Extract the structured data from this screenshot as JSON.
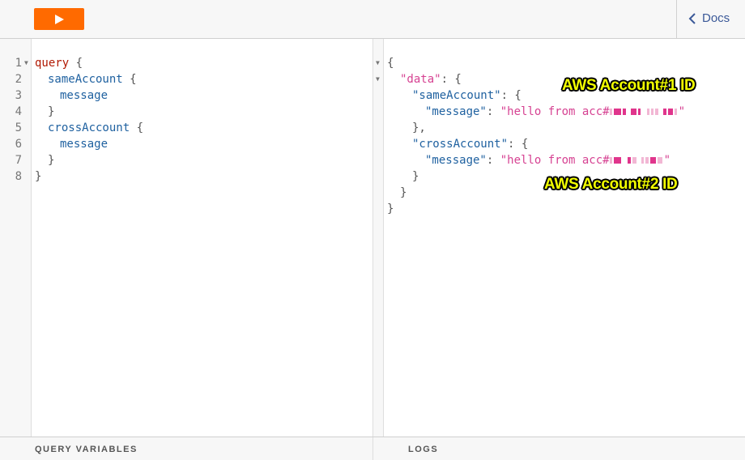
{
  "toolbar": {
    "run_icon": "play-icon",
    "docs_label": "Docs",
    "docs_icon": "chevron-left-icon",
    "accent_color": "#ff6a00"
  },
  "query_editor": {
    "line_numbers": [
      "1",
      "2",
      "3",
      "4",
      "5",
      "6",
      "7",
      "8"
    ],
    "tokens": {
      "l1_kw": "query",
      "l1_brace": " {",
      "l2_field": "sameAccount",
      "l2_brace": " {",
      "l3_field": "message",
      "l4_brace": "}",
      "l5_field": "crossAccount",
      "l5_brace": " {",
      "l6_field": "message",
      "l7_brace": "}",
      "l8_brace": "}"
    }
  },
  "result_viewer": {
    "tokens": {
      "open": "{",
      "data_key": "\"data\"",
      "data_sep": ": {",
      "same_key": "\"sameAccount\"",
      "same_sep": ": {",
      "same_msg_key": "\"message\"",
      "same_msg_sep": ": ",
      "same_msg_val": "\"hello from acc#",
      "same_msg_end": "\"",
      "same_close": "},",
      "cross_key": "\"crossAccount\"",
      "cross_sep": ": {",
      "cross_msg_key": "\"message\"",
      "cross_msg_sep": ": ",
      "cross_msg_val": "\"hello from acc#",
      "cross_msg_end": "\"",
      "cross_close": "}",
      "data_close": "}",
      "close": "}"
    },
    "annotations": {
      "account1": "AWS Account#1 ID",
      "account2": "AWS Account#2 ID"
    }
  },
  "bottom_bar": {
    "query_variables_label": "QUERY VARIABLES",
    "logs_label": "LOGS"
  }
}
